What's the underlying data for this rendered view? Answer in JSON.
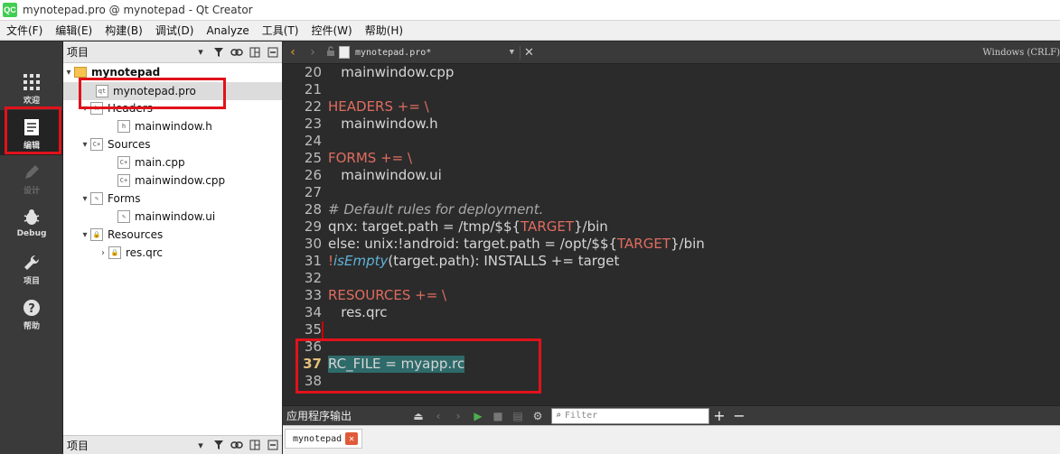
{
  "window": {
    "title": "mynotepad.pro @ mynotepad - Qt Creator",
    "logo_text": "QC"
  },
  "menubar": [
    "文件(F)",
    "编辑(E)",
    "构建(B)",
    "调试(D)",
    "Analyze",
    "工具(T)",
    "控件(W)",
    "帮助(H)"
  ],
  "modes": [
    {
      "label": "欢迎",
      "icon": "grid-icon"
    },
    {
      "label": "编辑",
      "icon": "edit-document-icon"
    },
    {
      "label": "设计",
      "icon": "pencil-icon"
    },
    {
      "label": "Debug",
      "icon": "bug-icon"
    },
    {
      "label": "项目",
      "icon": "wrench-icon"
    },
    {
      "label": "帮助",
      "icon": "help-icon"
    }
  ],
  "project_panel": {
    "title": "项目",
    "tree": [
      {
        "label": "mynotepad",
        "type": "project"
      },
      {
        "label": "mynotepad.pro",
        "type": "pro-file"
      },
      {
        "label": "Headers",
        "type": "folder"
      },
      {
        "label": "mainwindow.h",
        "type": "h-file"
      },
      {
        "label": "Sources",
        "type": "folder"
      },
      {
        "label": "main.cpp",
        "type": "cpp-file"
      },
      {
        "label": "mainwindow.cpp",
        "type": "cpp-file"
      },
      {
        "label": "Forms",
        "type": "folder"
      },
      {
        "label": "mainwindow.ui",
        "type": "ui-file"
      },
      {
        "label": "Resources",
        "type": "folder"
      },
      {
        "label": "res.qrc",
        "type": "qrc-file"
      }
    ]
  },
  "bottom_panel": {
    "title": "项目"
  },
  "editor": {
    "document": "mynotepad.pro*",
    "platform": "Windows (CRLF)",
    "current_line": "37",
    "lines": [
      {
        "n": "20",
        "text": "   mainwindow.cpp"
      },
      {
        "n": "21",
        "text": ""
      },
      {
        "n": "22",
        "kw": "HEADERS += \\"
      },
      {
        "n": "23",
        "text": "   mainwindow.h"
      },
      {
        "n": "24",
        "text": ""
      },
      {
        "n": "25",
        "kw": "FORMS += \\"
      },
      {
        "n": "26",
        "text": "   mainwindow.ui"
      },
      {
        "n": "27",
        "text": ""
      },
      {
        "n": "28",
        "comment": "# Default rules for deployment."
      },
      {
        "n": "29",
        "pre": "qnx: target.path = /tmp/$${",
        "var": "TARGET",
        "post": "}/bin"
      },
      {
        "n": "30",
        "pre": "else: unix:!android: target.path = /opt/$${",
        "var": "TARGET",
        "post": "}/bin"
      },
      {
        "n": "31",
        "pre": "!",
        "fn": "isEmpty",
        "post": "(target.path): INSTALLS += target"
      },
      {
        "n": "32",
        "text": ""
      },
      {
        "n": "33",
        "kw": "RESOURCES += \\"
      },
      {
        "n": "34",
        "text": "   res.qrc"
      },
      {
        "n": "35",
        "text": ""
      },
      {
        "n": "36",
        "text": ""
      },
      {
        "n": "37",
        "text": "RC_FILE = myapp.rc"
      },
      {
        "n": "38",
        "text": ""
      }
    ]
  },
  "output": {
    "title": "应用程序输出",
    "filter_placeholder": "Filter",
    "tab_label": "mynotepad"
  }
}
